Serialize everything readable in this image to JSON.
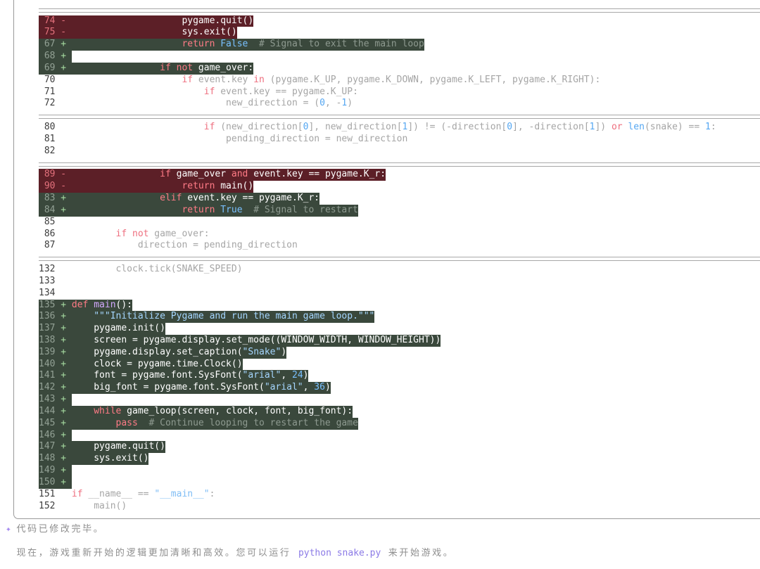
{
  "diff": {
    "hunks": [
      {
        "lines": [
          {
            "n": "74",
            "m": "-",
            "tokens": [
              {
                "txt": "                    pygame.quit()"
              }
            ]
          },
          {
            "n": "75",
            "m": "-",
            "tokens": [
              {
                "txt": "                    sys.exit()"
              }
            ]
          },
          {
            "n": "67",
            "m": "+",
            "tokens": [
              {
                "kw": "                    return"
              },
              {
                "const": " False"
              },
              {
                "com": "  # Signal to exit the main loop"
              }
            ]
          },
          {
            "n": "68",
            "m": "+",
            "tokens": []
          },
          {
            "n": "69",
            "m": "+",
            "tokens": [
              {
                "kw": "                if not"
              },
              {
                "txt": " game_over:"
              }
            ]
          },
          {
            "n": "70",
            "tokens": [
              {
                "kw": "                    if"
              },
              {
                "txt": " event.key "
              },
              {
                "kw": "in"
              },
              {
                "txt": " (pygame.K_UP, pygame.K_DOWN, pygame.K_LEFT, pygame.K_RIGHT):"
              }
            ]
          },
          {
            "n": "71",
            "tokens": [
              {
                "kw": "                        if"
              },
              {
                "txt": " event.key == pygame.K_UP:"
              }
            ]
          },
          {
            "n": "72",
            "tokens": [
              {
                "txt": "                            new_direction = ("
              },
              {
                "const": "0"
              },
              {
                "txt": ", -"
              },
              {
                "const": "1"
              },
              {
                "txt": ")"
              }
            ]
          }
        ]
      },
      {
        "lines": [
          {
            "n": "80",
            "tokens": [
              {
                "kw": "                        if"
              },
              {
                "txt": " (new_direction["
              },
              {
                "const": "0"
              },
              {
                "txt": "], new_direction["
              },
              {
                "const": "1"
              },
              {
                "txt": "]) != (-direction["
              },
              {
                "const": "0"
              },
              {
                "txt": "], -direction["
              },
              {
                "const": "1"
              },
              {
                "txt": "]) "
              },
              {
                "kw": "or"
              },
              {
                "const": " len"
              },
              {
                "txt": "(snake) == "
              },
              {
                "const": "1"
              },
              {
                "txt": ":"
              }
            ]
          },
          {
            "n": "81",
            "tokens": [
              {
                "txt": "                            pending_direction = new_direction"
              }
            ]
          },
          {
            "n": "82",
            "tokens": []
          }
        ]
      },
      {
        "lines": [
          {
            "n": "89",
            "m": "-",
            "tokens": [
              {
                "kw": "                if"
              },
              {
                "txt": " game_over "
              },
              {
                "kw": "and"
              },
              {
                "txt": " event.key == pygame.K_r:"
              }
            ]
          },
          {
            "n": "90",
            "m": "-",
            "tokens": [
              {
                "kw": "                    return"
              },
              {
                "txt": " main()"
              }
            ]
          },
          {
            "n": "83",
            "m": "+",
            "tokens": [
              {
                "kw": "                elif"
              },
              {
                "txt": " event.key == pygame.K_r:"
              }
            ]
          },
          {
            "n": "84",
            "m": "+",
            "tokens": [
              {
                "kw": "                    return"
              },
              {
                "const": " True"
              },
              {
                "com": "  # Signal to restart"
              }
            ]
          },
          {
            "n": "85",
            "tokens": []
          },
          {
            "n": "86",
            "tokens": [
              {
                "kw": "        if not"
              },
              {
                "txt": " game_over:"
              }
            ]
          },
          {
            "n": "87",
            "tokens": [
              {
                "txt": "            direction = pending_direction"
              }
            ]
          }
        ]
      },
      {
        "lines": [
          {
            "n": "132",
            "tokens": [
              {
                "txt": "        clock.tick(SNAKE_SPEED)"
              }
            ]
          },
          {
            "n": "133",
            "tokens": []
          },
          {
            "n": "134",
            "tokens": []
          },
          {
            "n": "135",
            "m": "+",
            "tokens": [
              {
                "kw": "def"
              },
              {
                "fn": " main"
              },
              {
                "txt": "():"
              }
            ]
          },
          {
            "n": "136",
            "m": "+",
            "tokens": [
              {
                "str": "    \"\"\"Initialize Pygame and run the main game loop.\"\"\""
              }
            ]
          },
          {
            "n": "137",
            "m": "+",
            "tokens": [
              {
                "txt": "    pygame.init()"
              }
            ]
          },
          {
            "n": "138",
            "m": "+",
            "tokens": [
              {
                "txt": "    screen = pygame.display.set_mode((WINDOW_WIDTH, WINDOW_HEIGHT))"
              }
            ]
          },
          {
            "n": "139",
            "m": "+",
            "tokens": [
              {
                "txt": "    pygame.display.set_caption("
              },
              {
                "str": "\"Snake\""
              },
              {
                "txt": ")"
              }
            ]
          },
          {
            "n": "140",
            "m": "+",
            "tokens": [
              {
                "txt": "    clock = pygame.time.Clock()"
              }
            ]
          },
          {
            "n": "141",
            "m": "+",
            "tokens": [
              {
                "txt": "    font = pygame.font.SysFont("
              },
              {
                "str": "\"arial\""
              },
              {
                "txt": ", "
              },
              {
                "const": "24"
              },
              {
                "txt": ")"
              }
            ]
          },
          {
            "n": "142",
            "m": "+",
            "tokens": [
              {
                "txt": "    big_font = pygame.font.SysFont("
              },
              {
                "str": "\"arial\""
              },
              {
                "txt": ", "
              },
              {
                "const": "36"
              },
              {
                "txt": ")"
              }
            ]
          },
          {
            "n": "143",
            "m": "+",
            "tokens": []
          },
          {
            "n": "144",
            "m": "+",
            "tokens": [
              {
                "kw": "    while"
              },
              {
                "txt": " game_loop(screen, clock, font, big_font):"
              }
            ]
          },
          {
            "n": "145",
            "m": "+",
            "tokens": [
              {
                "kw": "        pass"
              },
              {
                "com": "  # Continue looping to restart the game"
              }
            ]
          },
          {
            "n": "146",
            "m": "+",
            "tokens": []
          },
          {
            "n": "147",
            "m": "+",
            "tokens": [
              {
                "txt": "    pygame.quit()"
              }
            ]
          },
          {
            "n": "148",
            "m": "+",
            "tokens": [
              {
                "txt": "    sys.exit()"
              }
            ]
          },
          {
            "n": "149",
            "m": "+",
            "tokens": []
          },
          {
            "n": "150",
            "m": "+",
            "tokens": []
          },
          {
            "n": "151",
            "tokens": [
              {
                "kw": "if"
              },
              {
                "txt": " __name__ == "
              },
              {
                "str": "\"__main__\""
              },
              {
                "txt": ":"
              }
            ]
          },
          {
            "n": "152",
            "tokens": [
              {
                "txt": "    main()"
              }
            ]
          }
        ]
      }
    ]
  },
  "status": {
    "icon": "sparkle-icon",
    "symbol": "✦",
    "text": "代码已修改完毕。"
  },
  "message": {
    "before": "现在，游戏重新开始的逻辑更加清晰和高效。您可以运行 ",
    "command": "python snake.py",
    "after": " 来开始游戏。"
  },
  "colors": {
    "removed_bg": "#5c1f27",
    "added_bg": "#3a483c",
    "keyword": "#ff7b86",
    "constant": "#79c0ff",
    "string": "#a5d6ff",
    "comment": "#8e9a90",
    "function": "#d2a8ff",
    "border": "#9a9a9a",
    "accent": "#a58af0",
    "command": "#8b7ae6"
  }
}
